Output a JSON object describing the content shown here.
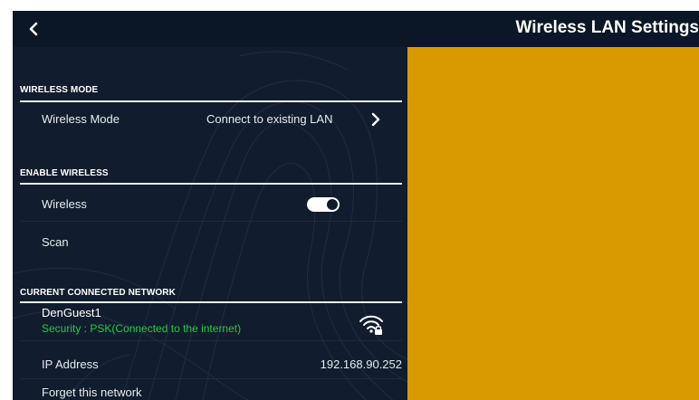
{
  "header": {
    "title": "Wireless LAN Settings",
    "back_icon": "chevron-left-icon"
  },
  "colors": {
    "panel_bg": "#111d2e",
    "topbar_bg": "#0b1626",
    "accent_panel": "#d99a00",
    "status_green": "#27c93f",
    "text": "#e6ebf1"
  },
  "sections": {
    "wireless_mode": {
      "header": "WIRELESS MODE",
      "row_label": "Wireless Mode",
      "row_value": "Connect to existing LAN",
      "chevron_icon": "chevron-right-icon"
    },
    "enable_wireless": {
      "header": "ENABLE WIRELESS",
      "wireless_label": "Wireless",
      "wireless_on": true,
      "scan_label": "Scan"
    },
    "current_network": {
      "header": "CURRENT CONNECTED NETWORK",
      "network_name": "DenGuest1",
      "security_status": "Security : PSK(Connected to the internet)",
      "signal_icon": "wifi-lock-icon",
      "ip_label": "IP Address",
      "ip_value": "192.168.90.252",
      "forget_label": "Forget this network"
    }
  }
}
